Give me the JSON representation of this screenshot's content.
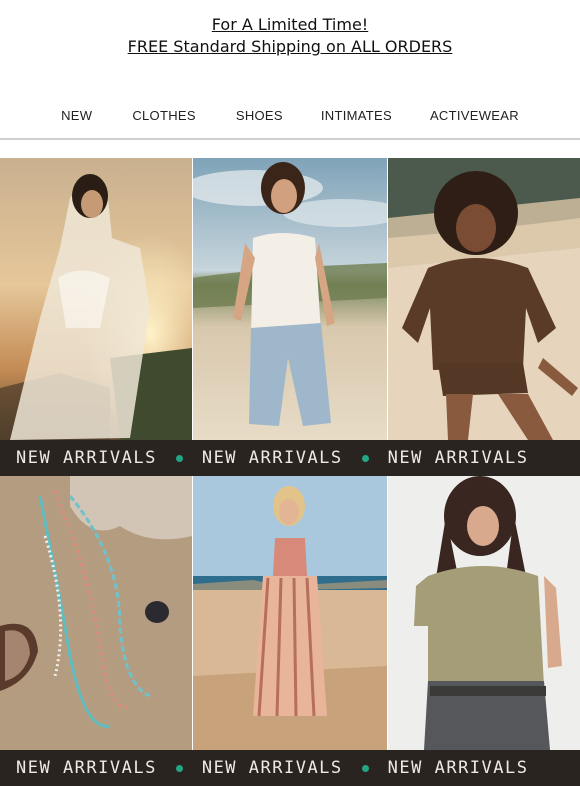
{
  "promo": {
    "line1": "For A Limited Time!",
    "line2": "FREE Standard Shipping on ALL ORDERS"
  },
  "nav": {
    "items": [
      {
        "label": "NEW"
      },
      {
        "label": "CLOTHES"
      },
      {
        "label": "SHOES"
      },
      {
        "label": "INTIMATES"
      },
      {
        "label": "ACTIVEWEAR"
      }
    ]
  },
  "banner": {
    "label": "NEW ARRIVALS",
    "dot_color": "#23a686",
    "background": "#2a2421"
  },
  "tiles": [
    {
      "name": "sheer-dress-sunset"
    },
    {
      "name": "white-halter-denim-shorts"
    },
    {
      "name": "brown-knit-set"
    },
    {
      "name": "beaded-necklaces"
    },
    {
      "name": "striped-wide-leg-pants"
    },
    {
      "name": "olive-polo-top"
    }
  ]
}
